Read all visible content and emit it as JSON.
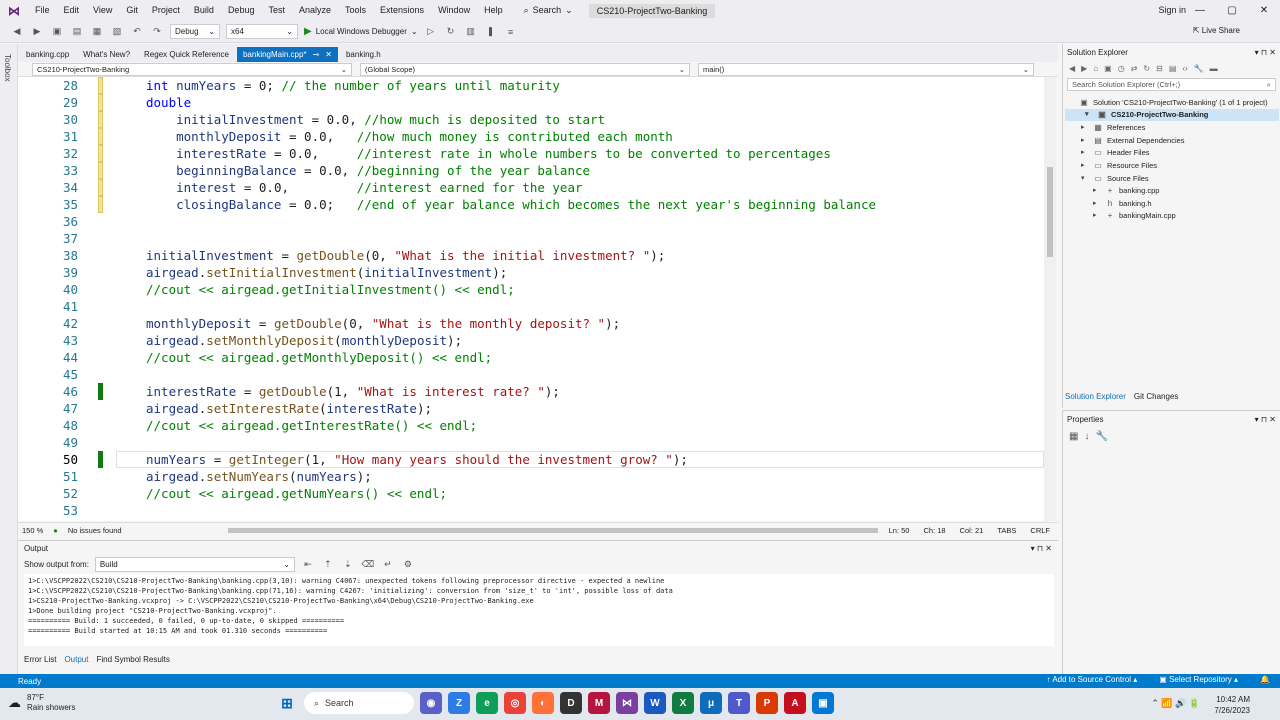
{
  "titlebar": {
    "menus": [
      "File",
      "Edit",
      "View",
      "Git",
      "Project",
      "Build",
      "Debug",
      "Test",
      "Analyze",
      "Tools",
      "Extensions",
      "Window",
      "Help"
    ],
    "search_label": "Search",
    "solution_title": "CS210-ProjectTwo-Banking",
    "signin": "Sign in"
  },
  "toolbar": {
    "config": "Debug",
    "platform": "x64",
    "run_label": "Local Windows Debugger",
    "liveshare": "Live Share"
  },
  "toolbox_label": "Toolbox",
  "tabs": [
    {
      "label": "banking.cpp",
      "active": false
    },
    {
      "label": "What's New?",
      "active": false
    },
    {
      "label": "Regex Quick Reference",
      "active": false
    },
    {
      "label": "bankingMain.cpp*",
      "active": true
    },
    {
      "label": "banking.h",
      "active": false
    }
  ],
  "navbar": {
    "project": "CS210-ProjectTwo-Banking",
    "scope": "(Global Scope)",
    "member": "main()"
  },
  "editor": {
    "current_line": 50,
    "lines": [
      {
        "n": "28",
        "t": [
          [
            "kw",
            "int "
          ],
          [
            "vr",
            "numYears"
          ],
          [
            "ty",
            " = 0; "
          ],
          [
            "cm",
            "// the number of years until maturity"
          ]
        ]
      },
      {
        "n": "29",
        "t": [
          [
            "kw",
            "double"
          ]
        ]
      },
      {
        "n": "30",
        "t": [
          [
            "vr",
            "    initialInvestment"
          ],
          [
            "ty",
            " = 0.0, "
          ],
          [
            "cm",
            "//how much is deposited to start"
          ]
        ]
      },
      {
        "n": "31",
        "t": [
          [
            "vr",
            "    monthlyDeposit"
          ],
          [
            "ty",
            " = 0.0,   "
          ],
          [
            "cm",
            "//how much money is contributed each month"
          ]
        ]
      },
      {
        "n": "32",
        "t": [
          [
            "vr",
            "    interestRate"
          ],
          [
            "ty",
            " = 0.0,     "
          ],
          [
            "cm",
            "//interest rate in whole numbers to be converted to percentages"
          ]
        ]
      },
      {
        "n": "33",
        "t": [
          [
            "vr",
            "    beginningBalance"
          ],
          [
            "ty",
            " = 0.0, "
          ],
          [
            "cm",
            "//beginning of the year balance"
          ]
        ]
      },
      {
        "n": "34",
        "t": [
          [
            "vr",
            "    interest"
          ],
          [
            "ty",
            " = 0.0,         "
          ],
          [
            "cm",
            "//interest earned for the year"
          ]
        ]
      },
      {
        "n": "35",
        "t": [
          [
            "vr",
            "    closingBalance"
          ],
          [
            "ty",
            " = 0.0;   "
          ],
          [
            "cm",
            "//end of year balance which becomes the next year's beginning balance"
          ]
        ]
      },
      {
        "n": "36",
        "t": []
      },
      {
        "n": "37",
        "t": []
      },
      {
        "n": "38",
        "t": [
          [
            "vr",
            "initialInvestment"
          ],
          [
            "ty",
            " = "
          ],
          [
            "fn",
            "getDouble"
          ],
          [
            "ty",
            "(0, "
          ],
          [
            "st",
            "\"What is the initial investment? \""
          ],
          [
            "ty",
            ");"
          ]
        ]
      },
      {
        "n": "39",
        "t": [
          [
            "vr",
            "airgead"
          ],
          [
            "ty",
            "."
          ],
          [
            "fn",
            "setInitialInvestment"
          ],
          [
            "ty",
            "("
          ],
          [
            "vr",
            "initialInvestment"
          ],
          [
            "ty",
            ");"
          ]
        ]
      },
      {
        "n": "40",
        "t": [
          [
            "cm",
            "//cout << airgead.getInitialInvestment() << endl;"
          ]
        ]
      },
      {
        "n": "41",
        "t": []
      },
      {
        "n": "42",
        "t": [
          [
            "vr",
            "monthlyDeposit"
          ],
          [
            "ty",
            " = "
          ],
          [
            "fn",
            "getDouble"
          ],
          [
            "ty",
            "(0, "
          ],
          [
            "st",
            "\"What is the monthly deposit? \""
          ],
          [
            "ty",
            ");"
          ]
        ]
      },
      {
        "n": "43",
        "t": [
          [
            "vr",
            "airgead"
          ],
          [
            "ty",
            "."
          ],
          [
            "fn",
            "setMonthlyDeposit"
          ],
          [
            "ty",
            "("
          ],
          [
            "vr",
            "monthlyDeposit"
          ],
          [
            "ty",
            ");"
          ]
        ]
      },
      {
        "n": "44",
        "t": [
          [
            "cm",
            "//cout << airgead.getMonthlyDeposit() << endl;"
          ]
        ]
      },
      {
        "n": "45",
        "t": []
      },
      {
        "n": "46",
        "t": [
          [
            "vr",
            "interestRate"
          ],
          [
            "ty",
            " = "
          ],
          [
            "fn",
            "getDouble"
          ],
          [
            "ty",
            "(1, "
          ],
          [
            "st",
            "\"What is interest rate? \""
          ],
          [
            "ty",
            ");"
          ]
        ]
      },
      {
        "n": "47",
        "t": [
          [
            "vr",
            "airgead"
          ],
          [
            "ty",
            "."
          ],
          [
            "fn",
            "setInterestRate"
          ],
          [
            "ty",
            "("
          ],
          [
            "vr",
            "interestRate"
          ],
          [
            "ty",
            ");"
          ]
        ]
      },
      {
        "n": "48",
        "t": [
          [
            "cm",
            "//cout << airgead.getInterestRate() << endl;"
          ]
        ]
      },
      {
        "n": "49",
        "t": []
      },
      {
        "n": "50",
        "t": [
          [
            "vr",
            "numYears"
          ],
          [
            "ty",
            " = "
          ],
          [
            "fn",
            "getInteger"
          ],
          [
            "ty",
            "(1, "
          ],
          [
            "st",
            "\"How many years should the investment grow? \""
          ],
          [
            "ty",
            ");"
          ]
        ]
      },
      {
        "n": "51",
        "t": [
          [
            "vr",
            "airgead"
          ],
          [
            "ty",
            "."
          ],
          [
            "fn",
            "setNumYears"
          ],
          [
            "ty",
            "("
          ],
          [
            "vr",
            "numYears"
          ],
          [
            "ty",
            ");"
          ]
        ]
      },
      {
        "n": "52",
        "t": [
          [
            "cm",
            "//cout << airgead.getNumYears() << endl;"
          ]
        ]
      },
      {
        "n": "53",
        "t": []
      }
    ],
    "change_marks": {
      "yellow": [
        "28",
        "29",
        "30",
        "31",
        "32",
        "33",
        "34",
        "35"
      ],
      "green": [
        "46",
        "50"
      ]
    }
  },
  "editor_status": {
    "zoom": "150 %",
    "issues": "No issues found",
    "line": "Ln: 50",
    "ch": "Ch: 18",
    "col": "Col: 21",
    "tabs": "TABS",
    "eol": "CRLF"
  },
  "output": {
    "title": "Output",
    "show_from_label": "Show output from:",
    "show_from_value": "Build",
    "lines": [
      "1>C:\\VSCPP2022\\CS210\\CS210-ProjectTwo-Banking\\banking.cpp(3,10): warning C4067: unexpected tokens following preprocessor directive - expected a newline",
      "1>C:\\VSCPP2022\\CS210\\CS210-ProjectTwo-Banking\\banking.cpp(71,16): warning C4267: 'initializing': conversion from 'size_t' to 'int', possible loss of data",
      "1>CS210-ProjectTwo-Banking.vcxproj -> C:\\VSCPP2022\\CS210\\CS210-ProjectTwo-Banking\\x64\\Debug\\CS210-ProjectTwo-Banking.exe",
      "1>Done building project \"CS210-ProjectTwo-Banking.vcxproj\".",
      "========== Build: 1 succeeded, 0 failed, 0 up-to-date, 0 skipped ==========",
      "========== Build started at 10:15 AM and took 01.310 seconds =========="
    ],
    "tabs": [
      "Error List",
      "Output",
      "Find Symbol Results"
    ]
  },
  "solution_explorer": {
    "title": "Solution Explorer",
    "search_placeholder": "Search Solution Explorer (Ctrl+;)",
    "solution": "Solution 'CS210-ProjectTwo-Banking' (1 of 1 project)",
    "project": "CS210-ProjectTwo-Banking",
    "nodes": [
      "References",
      "External Dependencies",
      "Header Files",
      "Resource Files",
      "Source Files"
    ],
    "files": [
      "banking.cpp",
      "banking.h",
      "bankingMain.cpp"
    ],
    "tabs": [
      "Solution Explorer",
      "Git Changes"
    ]
  },
  "properties": {
    "title": "Properties"
  },
  "statusbar": {
    "ready": "Ready",
    "source_control": "Add to Source Control",
    "repo": "Select Repository"
  },
  "taskbar": {
    "temp": "87°F",
    "weather": "Rain showers",
    "search": "Search",
    "time": "10:42 AM",
    "date": "7/26/2023"
  },
  "colors": {
    "accent": "#007acc",
    "active_tab": "#0e70c0"
  }
}
